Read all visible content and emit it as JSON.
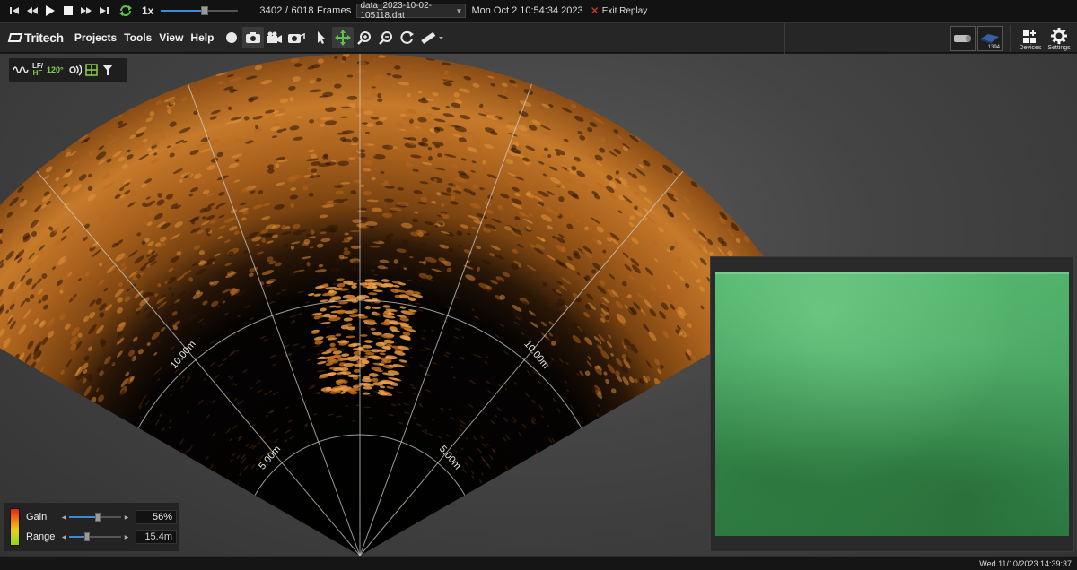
{
  "replay": {
    "speed": "1x",
    "position_fraction": 0.5655,
    "frame_current": "3402",
    "frame_sep": "/",
    "frame_total": "6018",
    "frames_label": "Frames",
    "file": "data_2023-10-02-105118.dat",
    "datetime": "Mon Oct 2 10:54:34 2023",
    "exit_label": "Exit Replay"
  },
  "menu": {
    "brand": "Tritech",
    "items": [
      "Projects",
      "Tools",
      "View",
      "Help"
    ],
    "devices_label": "Devices",
    "settings_label": "Settings",
    "device_thumb_label": "1394"
  },
  "sonar": {
    "range_labels": {
      "left_outer": "10.00m",
      "right_outer": "10.00m",
      "left_inner": "5.00m",
      "right_inner": "5.00m"
    },
    "tools": {
      "freq_top": "LF/",
      "freq_bottom": "HF",
      "aperture": "120°"
    }
  },
  "controls": {
    "gain_label": "Gain",
    "gain_value": "56%",
    "gain_fraction": 0.56,
    "range_label": "Range",
    "range_value": "15.4m",
    "range_fraction": 0.35
  },
  "status": {
    "timestamp": "Wed 11/10/2023 14:39:37"
  },
  "colors": {
    "accent": "#3d8ad6",
    "sonar_bright": "#f2a44a",
    "sonar_dark": "#1a0e05",
    "camera_green": "#3e9a58",
    "exit_red": "#e03b2f",
    "tool_green": "#8ad14a"
  }
}
